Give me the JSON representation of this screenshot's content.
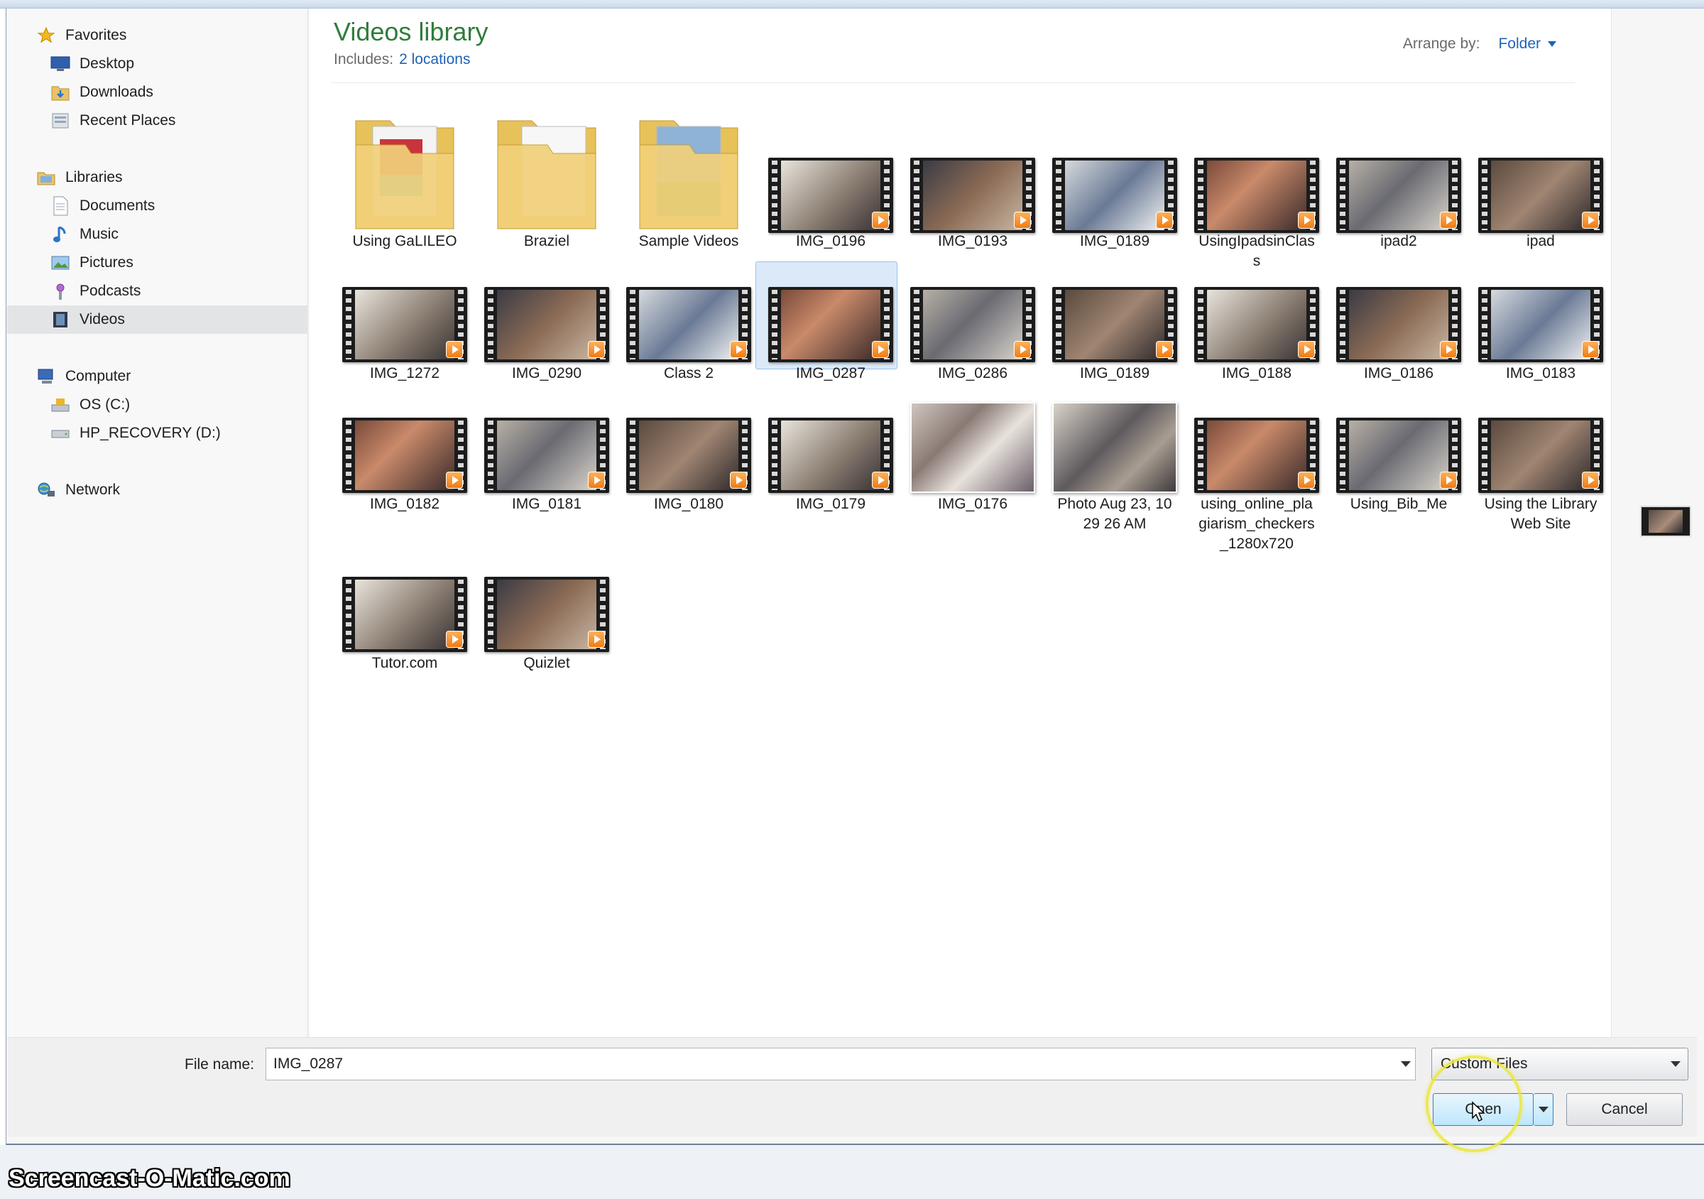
{
  "nav": {
    "favorites": "Favorites",
    "desktop": "Desktop",
    "downloads": "Downloads",
    "recent_places": "Recent Places",
    "libraries": "Libraries",
    "documents": "Documents",
    "music": "Music",
    "pictures": "Pictures",
    "podcasts": "Podcasts",
    "videos": "Videos",
    "computer": "Computer",
    "os_c": "OS (C:)",
    "hp_recovery": "HP_RECOVERY (D:)",
    "network": "Network"
  },
  "header": {
    "title": "Videos library",
    "includes_label": "Includes:",
    "includes_link": "2 locations",
    "arrange_label": "Arrange by:",
    "arrange_value": "Folder"
  },
  "items": [
    {
      "label": "Using GaLILEO",
      "kind": "folder"
    },
    {
      "label": "Braziel",
      "kind": "folder"
    },
    {
      "label": "Sample Videos",
      "kind": "folder"
    },
    {
      "label": "IMG_0196",
      "kind": "video"
    },
    {
      "label": "IMG_0193",
      "kind": "video"
    },
    {
      "label": "IMG_0189",
      "kind": "video"
    },
    {
      "label": "UsingIpadsinClas\ns",
      "kind": "video"
    },
    {
      "label": "ipad2",
      "kind": "video"
    },
    {
      "label": "ipad",
      "kind": "video"
    },
    {
      "label": "IMG_1272",
      "kind": "video"
    },
    {
      "label": "IMG_0290",
      "kind": "video"
    },
    {
      "label": "Class 2",
      "kind": "video"
    },
    {
      "label": "IMG_0287",
      "kind": "video",
      "selected": true
    },
    {
      "label": "IMG_0286",
      "kind": "video"
    },
    {
      "label": "IMG_0189",
      "kind": "video"
    },
    {
      "label": "IMG_0188",
      "kind": "video"
    },
    {
      "label": "IMG_0186",
      "kind": "video"
    },
    {
      "label": "IMG_0183",
      "kind": "video"
    },
    {
      "label": "IMG_0182",
      "kind": "video"
    },
    {
      "label": "IMG_0181",
      "kind": "video"
    },
    {
      "label": "IMG_0180",
      "kind": "video"
    },
    {
      "label": "IMG_0179",
      "kind": "video"
    },
    {
      "label": "IMG_0176",
      "kind": "photo"
    },
    {
      "label": "Photo Aug 23, 10\n29 26 AM",
      "kind": "photo"
    },
    {
      "label": "using_online_pla\ngiarism_checkers\n_1280x720",
      "kind": "video"
    },
    {
      "label": "Using_Bib_Me",
      "kind": "video"
    },
    {
      "label": "Using the Library\nWeb Site",
      "kind": "video"
    },
    {
      "label": "Tutor.com",
      "kind": "video"
    },
    {
      "label": "Quizlet",
      "kind": "video"
    }
  ],
  "footer": {
    "file_name_label": "File name:",
    "file_name_value": "IMG_0287",
    "filter_value": "Custom Files",
    "open_label": "Open",
    "cancel_label": "Cancel"
  },
  "watermark": "Screencast-O-Matic.com",
  "colors": {
    "title_green": "#2f7d3a",
    "link_blue": "#1f63b8",
    "play_orange": "#f07b11",
    "selection_blue": "#dbe9f8",
    "highlight_yellow": "#ebe63c"
  }
}
